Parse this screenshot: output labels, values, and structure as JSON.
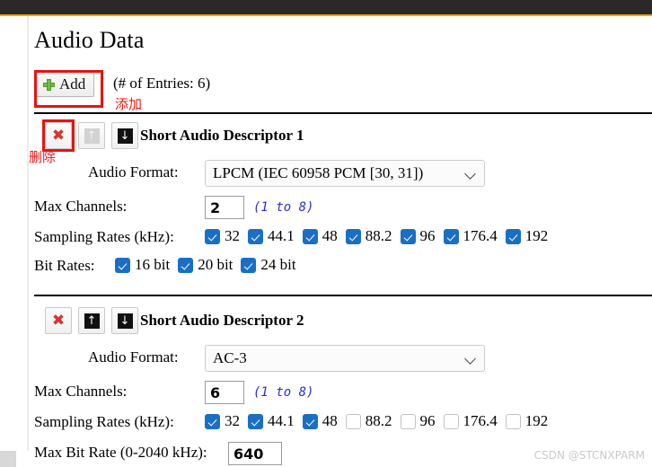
{
  "window": {
    "titlebar_color": "#2b2829",
    "accent_color": "#f5a500"
  },
  "page": {
    "title": "Audio Data",
    "entries_label": "(# of Entries: 6)"
  },
  "toolbar": {
    "add_label": "Add",
    "add_icon": "plus-icon",
    "add_annotation_cn": "添加"
  },
  "annotations": {
    "delete_cn": "删除",
    "box_color": "#e8130f"
  },
  "icons": {
    "delete": "✖",
    "move_up": "↑",
    "move_down": "↓"
  },
  "labels": {
    "audio_format": "Audio Format:",
    "max_channels": "Max Channels:",
    "sampling_rates": "Sampling Rates (kHz):",
    "bit_rates": "Bit Rates:",
    "max_bit_rate": "Max Bit Rate (0-2040 kHz):",
    "channels_hint": "(1 to 8)"
  },
  "descriptors": [
    {
      "title": "Short Audio Descriptor 1",
      "audio_format": "LPCM (IEC 60958 PCM [30, 31])",
      "max_channels": "2",
      "up_enabled": false,
      "down_enabled": true,
      "sampling_rates": [
        {
          "label": "32",
          "checked": true
        },
        {
          "label": "44.1",
          "checked": true
        },
        {
          "label": "48",
          "checked": true
        },
        {
          "label": "88.2",
          "checked": true
        },
        {
          "label": "96",
          "checked": true
        },
        {
          "label": "176.4",
          "checked": true
        },
        {
          "label": "192",
          "checked": true
        }
      ],
      "bit_rates": [
        {
          "label": "16 bit",
          "checked": true
        },
        {
          "label": "20 bit",
          "checked": true
        },
        {
          "label": "24 bit",
          "checked": true
        }
      ]
    },
    {
      "title": "Short Audio Descriptor 2",
      "audio_format": "AC-3",
      "max_channels": "6",
      "up_enabled": true,
      "down_enabled": true,
      "sampling_rates": [
        {
          "label": "32",
          "checked": true
        },
        {
          "label": "44.1",
          "checked": true
        },
        {
          "label": "48",
          "checked": true
        },
        {
          "label": "88.2",
          "checked": false
        },
        {
          "label": "96",
          "checked": false
        },
        {
          "label": "176.4",
          "checked": false
        },
        {
          "label": "192",
          "checked": false
        }
      ],
      "max_bit_rate": "640"
    }
  ],
  "watermark": "CSDN @STCNXPARM"
}
